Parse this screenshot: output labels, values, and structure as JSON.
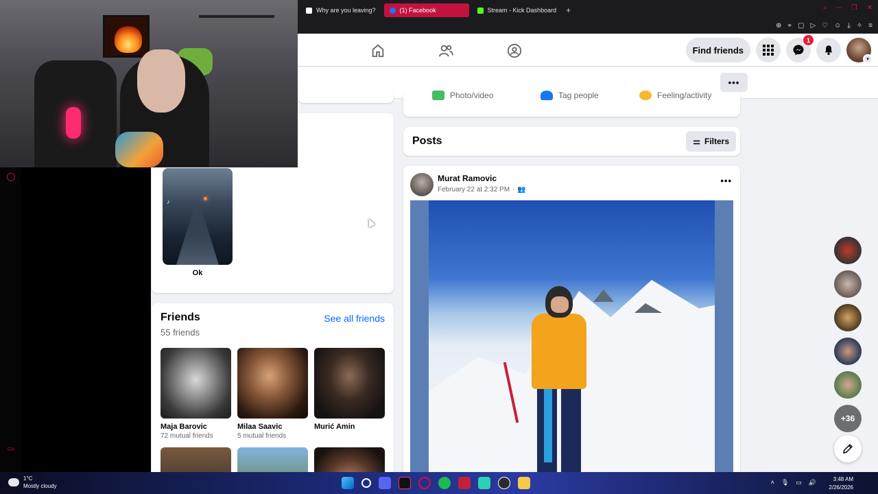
{
  "browser": {
    "tabs": [
      {
        "label": "Why are you leaving?",
        "color": "#ffffff"
      },
      {
        "label": "(1) Facebook",
        "color": "#1877f2"
      },
      {
        "label": "Stream - Kick Dashboard",
        "color": "#53fc18"
      }
    ],
    "active_tab_color": "#c21240"
  },
  "facebook": {
    "nav": {
      "find_friends": "Find friends",
      "messenger_badge": "1"
    },
    "composer": {
      "photo_video": "Photo/video",
      "tag_people": "Tag people",
      "feeling_activity": "Feeling/activity"
    },
    "reels": {
      "label": "Ok"
    },
    "friends": {
      "title": "Friends",
      "count": "55 friends",
      "see_all": "See all friends",
      "items": [
        {
          "name": "Maja Barovic",
          "mutual": "72 mutual friends"
        },
        {
          "name": "Milaa Saavic",
          "mutual": "5 mutual friends"
        },
        {
          "name": "Murić Amin",
          "mutual": ""
        }
      ]
    },
    "posts": {
      "title": "Posts",
      "filters": "Filters",
      "post": {
        "author": "Murat Ramovic",
        "date": "February 22 at 2:32 PM"
      }
    },
    "contacts": {
      "more": "+36"
    }
  },
  "taskbar": {
    "temperature": "1°C",
    "weather": "Mostly cloudy",
    "time": "3:48 AM",
    "date": "2/26/2026"
  }
}
